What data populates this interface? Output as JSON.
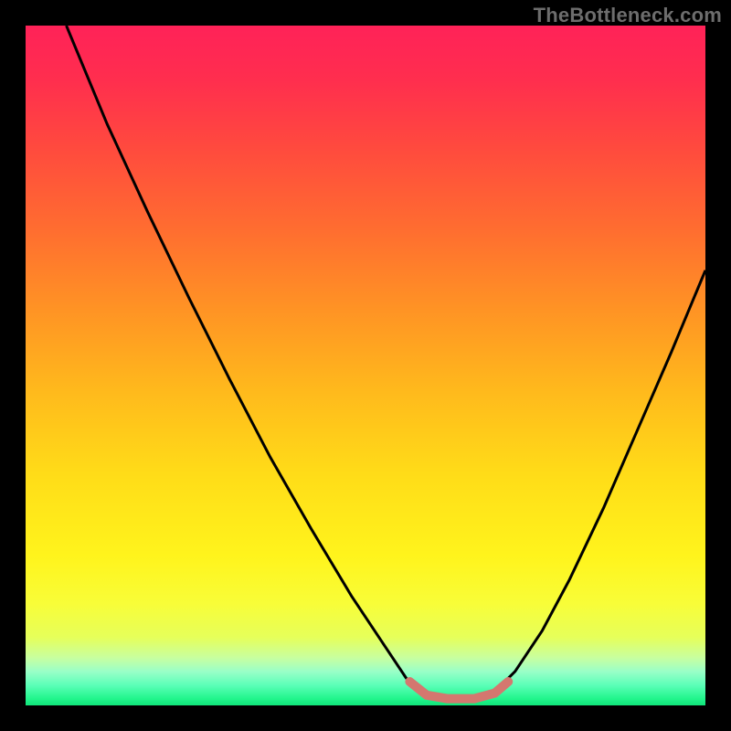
{
  "watermark": "TheBottleneck.com",
  "chart_data": {
    "type": "line",
    "title": "",
    "xlabel": "",
    "ylabel": "",
    "xlim": [
      0,
      1
    ],
    "ylim": [
      0,
      1
    ],
    "annotations": [],
    "gradient_stops": [
      {
        "pos": 0.0,
        "color": "#ff2258"
      },
      {
        "pos": 0.08,
        "color": "#ff2e4e"
      },
      {
        "pos": 0.18,
        "color": "#ff4a3e"
      },
      {
        "pos": 0.3,
        "color": "#ff6d30"
      },
      {
        "pos": 0.42,
        "color": "#ff9424"
      },
      {
        "pos": 0.54,
        "color": "#ffba1c"
      },
      {
        "pos": 0.66,
        "color": "#ffdc18"
      },
      {
        "pos": 0.78,
        "color": "#fff41c"
      },
      {
        "pos": 0.85,
        "color": "#f8fd38"
      },
      {
        "pos": 0.9,
        "color": "#e6ff5a"
      },
      {
        "pos": 0.93,
        "color": "#c8ffa0"
      },
      {
        "pos": 0.95,
        "color": "#9affc8"
      },
      {
        "pos": 0.97,
        "color": "#5cffb8"
      },
      {
        "pos": 0.99,
        "color": "#22f58c"
      },
      {
        "pos": 1.0,
        "color": "#10e47a"
      }
    ],
    "series": [
      {
        "name": "curve",
        "color": "#000000",
        "width": 3,
        "points": [
          {
            "x": 0.06,
            "y": 1.0
          },
          {
            "x": 0.12,
            "y": 0.855
          },
          {
            "x": 0.18,
            "y": 0.725
          },
          {
            "x": 0.24,
            "y": 0.6
          },
          {
            "x": 0.3,
            "y": 0.48
          },
          {
            "x": 0.36,
            "y": 0.365
          },
          {
            "x": 0.42,
            "y": 0.26
          },
          {
            "x": 0.48,
            "y": 0.16
          },
          {
            "x": 0.53,
            "y": 0.085
          },
          {
            "x": 0.56,
            "y": 0.04
          },
          {
            "x": 0.585,
            "y": 0.018
          },
          {
            "x": 0.61,
            "y": 0.01
          },
          {
            "x": 0.66,
            "y": 0.01
          },
          {
            "x": 0.69,
            "y": 0.02
          },
          {
            "x": 0.72,
            "y": 0.05
          },
          {
            "x": 0.76,
            "y": 0.11
          },
          {
            "x": 0.8,
            "y": 0.185
          },
          {
            "x": 0.85,
            "y": 0.29
          },
          {
            "x": 0.9,
            "y": 0.405
          },
          {
            "x": 0.95,
            "y": 0.52
          },
          {
            "x": 1.0,
            "y": 0.64
          }
        ]
      },
      {
        "name": "highlight",
        "color": "#d4776f",
        "width": 10,
        "linecap": "round",
        "points": [
          {
            "x": 0.565,
            "y": 0.035
          },
          {
            "x": 0.59,
            "y": 0.015
          },
          {
            "x": 0.62,
            "y": 0.01
          },
          {
            "x": 0.66,
            "y": 0.01
          },
          {
            "x": 0.69,
            "y": 0.018
          },
          {
            "x": 0.71,
            "y": 0.035
          }
        ]
      }
    ]
  }
}
